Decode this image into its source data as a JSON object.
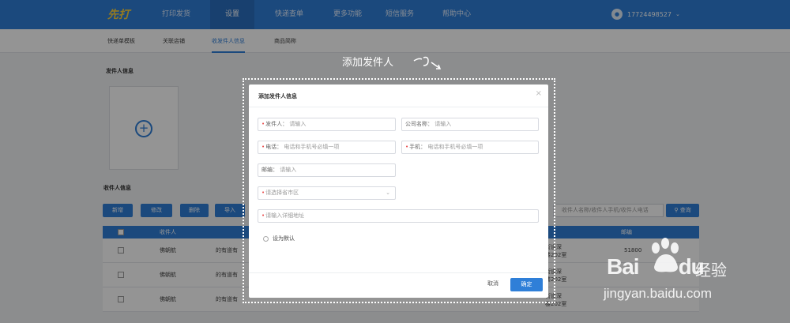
{
  "app": {
    "logo_text": "先打",
    "nav": [
      "打印发货",
      "设置",
      "快递查单",
      "更多功能",
      "短信服务",
      "帮助中心"
    ],
    "active_nav_index": 1,
    "user": "17724498527"
  },
  "subnav": {
    "tabs": [
      "快递单模板",
      "关联店铺",
      "收发件人信息",
      "商品简称"
    ],
    "active_index": 2
  },
  "sender_section": {
    "title": "发件人信息"
  },
  "receiver_section": {
    "title": "收件人信息",
    "buttons": [
      "新增",
      "修改",
      "删除",
      "导入"
    ],
    "search_placeholder": "收件人名称/收件人手机/收件人电话",
    "search_button": "查询",
    "columns": [
      "收件人",
      "邮编"
    ],
    "rows": [
      {
        "name": "佛朝航",
        "partial": "的有道有",
        "addr1": "街道深",
        "addr2": "楼202室",
        "zip": "51800"
      },
      {
        "name": "佛朝航",
        "partial": "的有道有",
        "addr1": "街道深",
        "addr2": "楼202室",
        "zip": ""
      },
      {
        "name": "佛朝航",
        "partial": "的有道有",
        "addr1": "街道深",
        "addr2": "楼202室",
        "zip": ""
      }
    ]
  },
  "annotation": {
    "label": "添加发件人"
  },
  "modal": {
    "title": "添加发件人信息",
    "close": "×",
    "fields": {
      "sender": {
        "label": "发件人：",
        "placeholder": "请输入"
      },
      "company": {
        "label": "公司名称：",
        "placeholder": "请输入"
      },
      "phone": {
        "label": "电话：",
        "placeholder": "电话和手机号必填一项"
      },
      "mobile": {
        "label": "手机：",
        "placeholder": "电话和手机号必填一项"
      },
      "zip": {
        "label": "邮编：",
        "placeholder": "请输入"
      },
      "region": {
        "placeholder": "请选择省市区"
      },
      "address": {
        "placeholder": "请输入详细地址"
      }
    },
    "default_label": "设为默认",
    "cancel": "取消",
    "confirm": "确定"
  },
  "watermark": {
    "brand": "Bai",
    "brand2": "du",
    "cn": "经验",
    "url": "jingyan.baidu.com"
  }
}
